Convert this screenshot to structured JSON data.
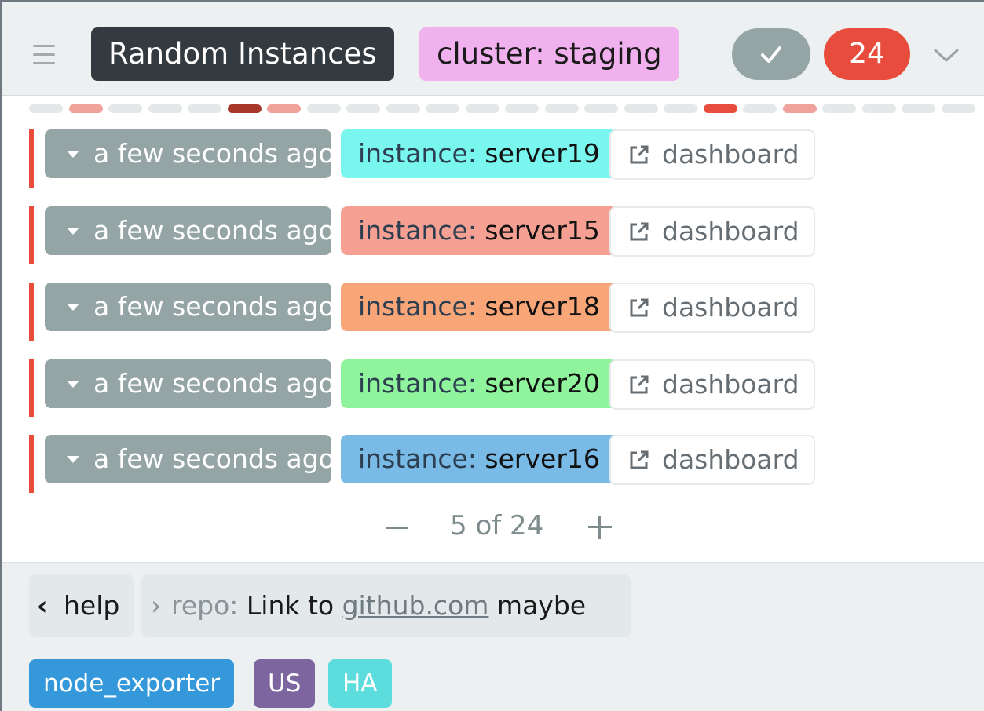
{
  "header": {
    "title": "Random Instances",
    "cluster": {
      "name": "cluster",
      "value": "staging"
    },
    "count": "24",
    "colors": {
      "title_bg": "#333b40",
      "cluster_bg": "#f1b0ee",
      "ack_bg": "#95a5a6",
      "count_bg": "#e74c3c"
    },
    "icons": {
      "menu": "hamburger-icon",
      "ack": "check-icon",
      "toggle": "chevron-down-icon"
    }
  },
  "strip": {
    "segments": [
      "#e5e8e8",
      "#f0a39a",
      "#e5e8e8",
      "#e5e8e8",
      "#e5e8e8",
      "#a8372a",
      "#f0a39a",
      "#e5e8e8",
      "#e5e8e8",
      "#e5e8e8",
      "#e5e8e8",
      "#e5e8e8",
      "#e5e8e8",
      "#e5e8e8",
      "#e5e8e8",
      "#e5e8e8",
      "#e5e8e8",
      "#e74c3c",
      "#e5e8e8",
      "#f0a39a",
      "#e5e8e8",
      "#e5e8e8",
      "#e5e8e8",
      "#e5e8e8"
    ]
  },
  "alerts": [
    {
      "time": "a few seconds ago",
      "label_name": "instance",
      "label_value": "server19",
      "color": "#79f6ee",
      "link": "dashboard"
    },
    {
      "time": "a few seconds ago",
      "label_name": "instance",
      "label_value": "server15",
      "color": "#f5a093",
      "link": "dashboard"
    },
    {
      "time": "a few seconds ago",
      "label_name": "instance",
      "label_value": "server18",
      "color": "#f8a578",
      "link": "dashboard"
    },
    {
      "time": "a few seconds ago",
      "label_name": "instance",
      "label_value": "server20",
      "color": "#8ff49c",
      "link": "dashboard"
    },
    {
      "time": "a few seconds ago",
      "label_name": "instance",
      "label_value": "server16",
      "color": "#79bae6",
      "link": "dashboard"
    }
  ],
  "pager": {
    "label": "5 of 24"
  },
  "footer": {
    "help": "help",
    "annotation": {
      "key": "repo:",
      "pre": "Link to",
      "link": "github.com",
      "post": "maybe"
    },
    "labels": [
      {
        "text": "node_exporter",
        "color": "#3498db"
      },
      {
        "text": "US",
        "color": "#7d66a0"
      },
      {
        "text": "HA",
        "color": "#5ddcde"
      }
    ]
  }
}
